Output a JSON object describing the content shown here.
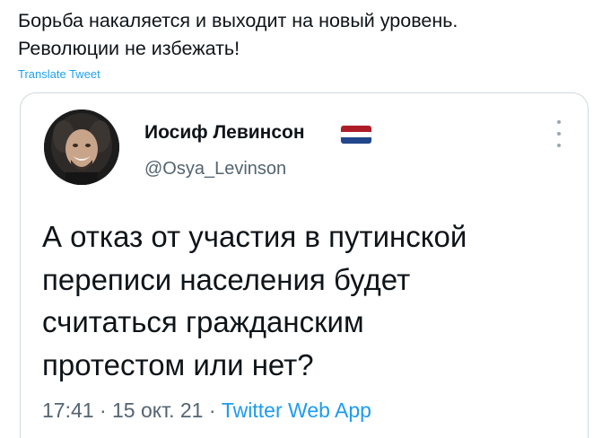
{
  "tweet": {
    "text_line1": "Борьба накаляется и выходит на новый уровень.",
    "text_line2": "Революции не избежать!",
    "translate_label": "Translate Tweet"
  },
  "quoted": {
    "author_name": "Иосиф Левинсон",
    "handle": "@Osya_Levinson",
    "body_line1": "А отказ от участия в путинской",
    "body_line2": "переписи населения будет",
    "body_line3": "считаться гражданским",
    "body_line4": "протестом или нет?",
    "time": "17:41",
    "separator": "·",
    "date": "15 окт. 21",
    "source_app": "Twitter Web App",
    "flag_icon": "netherlands-flag-icon"
  },
  "colors": {
    "link": "#1da1f2",
    "secondary_text": "#536471",
    "border": "#cfd9de",
    "flag_red": "#ae1c28",
    "flag_white": "#ffffff",
    "flag_blue": "#21468b"
  }
}
